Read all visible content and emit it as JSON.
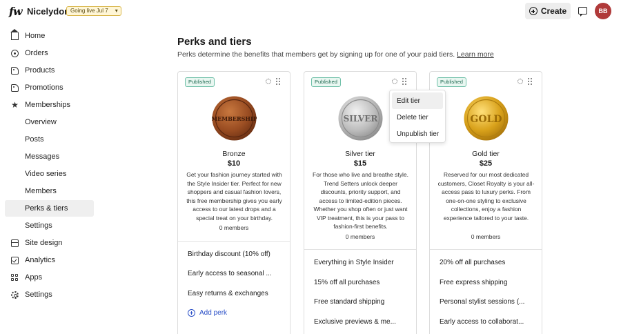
{
  "topbar": {
    "logo": "fw",
    "brand": "Nicelydone",
    "go_live": "Going live Jul 7",
    "create_label": "Create",
    "avatar_initials": "BB"
  },
  "sidebar": {
    "items": [
      {
        "label": "Home",
        "icon": "home-icon"
      },
      {
        "label": "Orders",
        "icon": "orders-icon"
      },
      {
        "label": "Products",
        "icon": "products-icon"
      },
      {
        "label": "Promotions",
        "icon": "promotions-icon"
      },
      {
        "label": "Memberships",
        "icon": "star-icon"
      },
      {
        "label": "Overview"
      },
      {
        "label": "Posts"
      },
      {
        "label": "Messages"
      },
      {
        "label": "Video series"
      },
      {
        "label": "Members"
      },
      {
        "label": "Perks & tiers",
        "active": true
      },
      {
        "label": "Settings"
      },
      {
        "label": "Site design",
        "icon": "site-design-icon"
      },
      {
        "label": "Analytics",
        "icon": "analytics-icon"
      },
      {
        "label": "Apps",
        "icon": "apps-icon"
      },
      {
        "label": "Settings",
        "icon": "gear-icon"
      }
    ]
  },
  "main": {
    "title": "Perks and tiers",
    "subtitle": "Perks determine the benefits that members get by signing up for one of your paid tiers.",
    "learn_more": "Learn more"
  },
  "tiers": [
    {
      "status": "Published",
      "medal_text": "MEMBERSHIP",
      "name": "Bronze",
      "price": "$10",
      "description": "Get your fashion journey started with the Style Insider tier. Perfect for new shoppers and casual fashion lovers, this free membership gives you early access to our latest drops and a special treat on your birthday.",
      "members": "0 members",
      "perks": [
        "Birthday discount (10% off)",
        "Early access to seasonal ...",
        "Easy returns & exchanges"
      ],
      "add_perk": "Add perk"
    },
    {
      "status": "Published",
      "medal_text": "SILVER",
      "name": "Silver tier",
      "price": "$15",
      "description": "For those who live and breathe style. Trend Setters unlock deeper discounts, priority support, and access to limited-edition pieces. Whether you shop often or just want VIP treatment, this is your pass to fashion-first benefits.",
      "members": "0 members",
      "perks": [
        "Everything in Style Insider",
        "15% off all purchases",
        "Free standard shipping",
        "Exclusive previews & me..."
      ]
    },
    {
      "status": "Published",
      "medal_text": "GOLD",
      "name": "Gold tier",
      "price": "$25",
      "description": "Reserved for our most dedicated customers, Closet Royalty is your all-access pass to luxury perks. From one-on-one styling to exclusive collections, enjoy a fashion experience tailored to your taste.",
      "members": "0 members",
      "perks": [
        "20% off all purchases",
        "Free express shipping",
        "Personal stylist sessions (...",
        "Early access to collaborat..."
      ]
    }
  ],
  "tier_menu": {
    "items": [
      "Edit tier",
      "Delete tier",
      "Unpublish tier"
    ]
  },
  "colors": {
    "bronze": "#a0522d",
    "silver": "#b8b8b8",
    "gold": "#d4a017",
    "avatar": "#b03a3a",
    "link": "#2a4fc7"
  }
}
